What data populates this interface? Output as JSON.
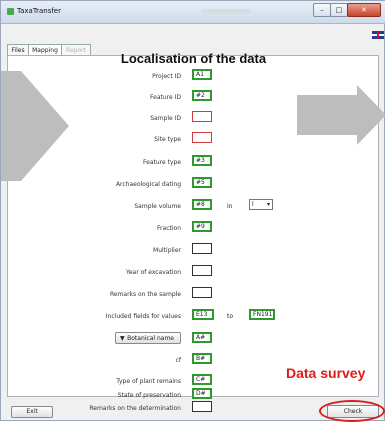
{
  "window": {
    "title": "TaxaTransfer"
  },
  "tabs": [
    {
      "label": "Files"
    },
    {
      "label": "Mapping"
    },
    {
      "label": "Report"
    }
  ],
  "heading": "Localisation of the data",
  "fields": [
    {
      "label": "Project ID",
      "value": "A1"
    },
    {
      "label": "Feature ID",
      "value": "#2"
    },
    {
      "label": "Sample ID",
      "value": ""
    },
    {
      "label": "Site type",
      "value": ""
    },
    {
      "label": "Feature type",
      "value": "#3"
    },
    {
      "label": "Archaeological dating",
      "value": "#5"
    },
    {
      "label": "Sample volume",
      "value": "#8"
    },
    {
      "label": "Fraction",
      "value": "#9"
    },
    {
      "label": "Multiplier",
      "value": ""
    },
    {
      "label": "Year of excavation",
      "value": ""
    },
    {
      "label": "Remarks on the sample",
      "value": ""
    },
    {
      "label": "Included fields for values",
      "value": "E13"
    },
    {
      "label": "Botanical name",
      "value": "A#"
    },
    {
      "label": "cf",
      "value": "B#"
    },
    {
      "label": "Type of plant remains",
      "value": "C#"
    },
    {
      "label": "State of preservation",
      "value": "D#"
    },
    {
      "label": "Remarks on the determination",
      "value": ""
    }
  ],
  "sample_volume": {
    "in_label": "in",
    "unit": "l"
  },
  "included_fields": {
    "to_label": "to",
    "to_value": "FN191"
  },
  "botanical_dropdown_arrow": "▼",
  "buttons": {
    "exit": "Exit",
    "check": "Check"
  },
  "annotation": "Data survey",
  "colors": {
    "valid_border": "#2e9a2e",
    "missing_border": "#d23b3b",
    "annotation": "#e01b1b"
  },
  "icons": [
    "app-icon",
    "minimize-icon",
    "maximize-icon",
    "close-icon",
    "uk-flag-icon"
  ]
}
